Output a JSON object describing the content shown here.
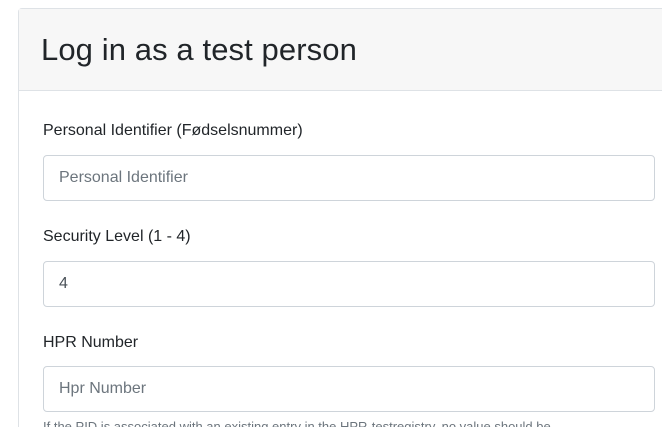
{
  "header": {
    "title": "Log in as a test person"
  },
  "form": {
    "pid": {
      "label": "Personal Identifier (Fødselsnummer)",
      "placeholder": "Personal Identifier",
      "value": ""
    },
    "security_level": {
      "label": "Security Level (1 - 4)",
      "value": "4"
    },
    "hpr": {
      "label": "HPR Number",
      "placeholder": "Hpr Number",
      "value": "",
      "help_text": "If the PID is associated with an existing entry in the HPR-testregistry, no value should be"
    }
  }
}
